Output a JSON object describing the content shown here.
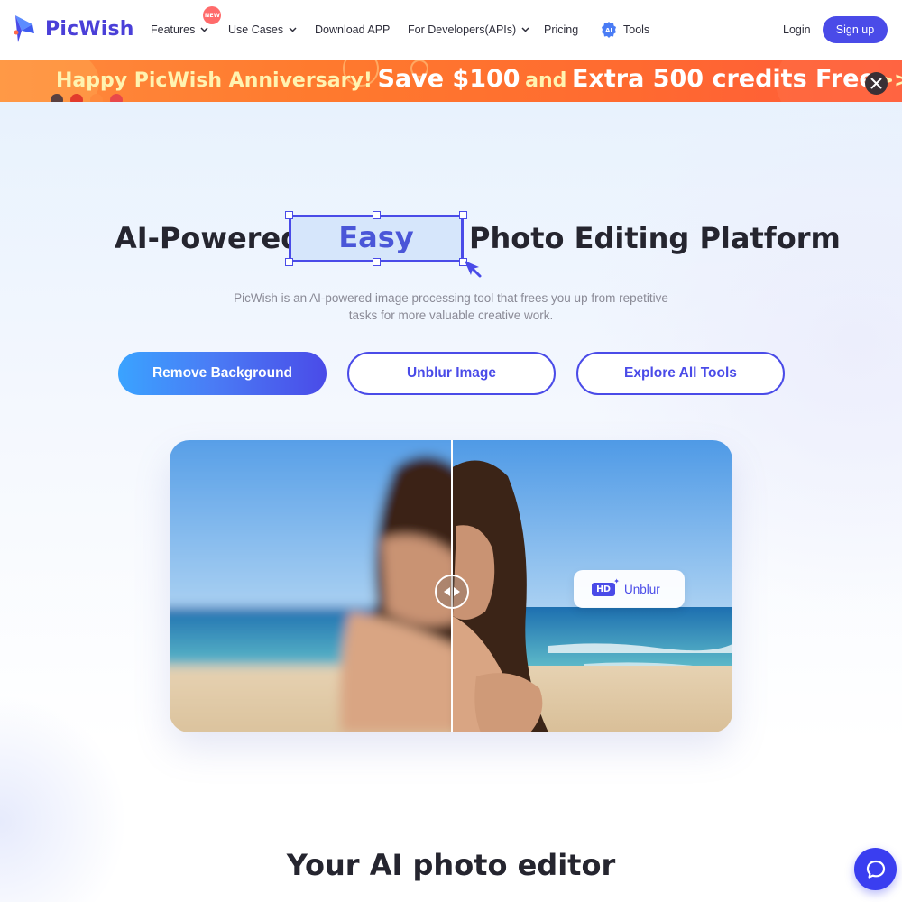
{
  "header": {
    "logo_text": "PicWish",
    "nav": [
      {
        "label": "Features",
        "has_dropdown": true,
        "badge": "NEW"
      },
      {
        "label": "Use Cases",
        "has_dropdown": true
      },
      {
        "label": "Download APP",
        "has_dropdown": false
      },
      {
        "label": "For Developers(APIs)",
        "has_dropdown": true
      },
      {
        "label": "Pricing",
        "has_dropdown": false
      },
      {
        "label": "Tools",
        "has_dropdown": false,
        "icon": "ai-icon"
      }
    ],
    "login": "Login",
    "signup": "Sign up"
  },
  "banner": {
    "part1": "Happy PicWish Anniversary!",
    "part2": "Save $100",
    "part3": "and",
    "part4": "Extra 500 credits Free",
    "arrows": ">>",
    "close_icon": "close-icon"
  },
  "hero": {
    "headline_left": "AI-Powered",
    "headline_highlight": "Easy",
    "headline_right": "Photo Editing Platform",
    "subtitle": "PicWish is an AI-powered image processing tool that frees you up from repetitive tasks for more valuable creative work.",
    "buttons": {
      "remove_bg": "Remove Background",
      "unblur": "Unblur Image",
      "explore": "Explore All Tools"
    }
  },
  "demo": {
    "hd_badge": "HD",
    "tag_label": "Unblur"
  },
  "section": {
    "title": "Your AI photo editor"
  },
  "colors": {
    "brand": "#4a4be8",
    "banner": "#ff7a2e",
    "text": "#25252f"
  }
}
